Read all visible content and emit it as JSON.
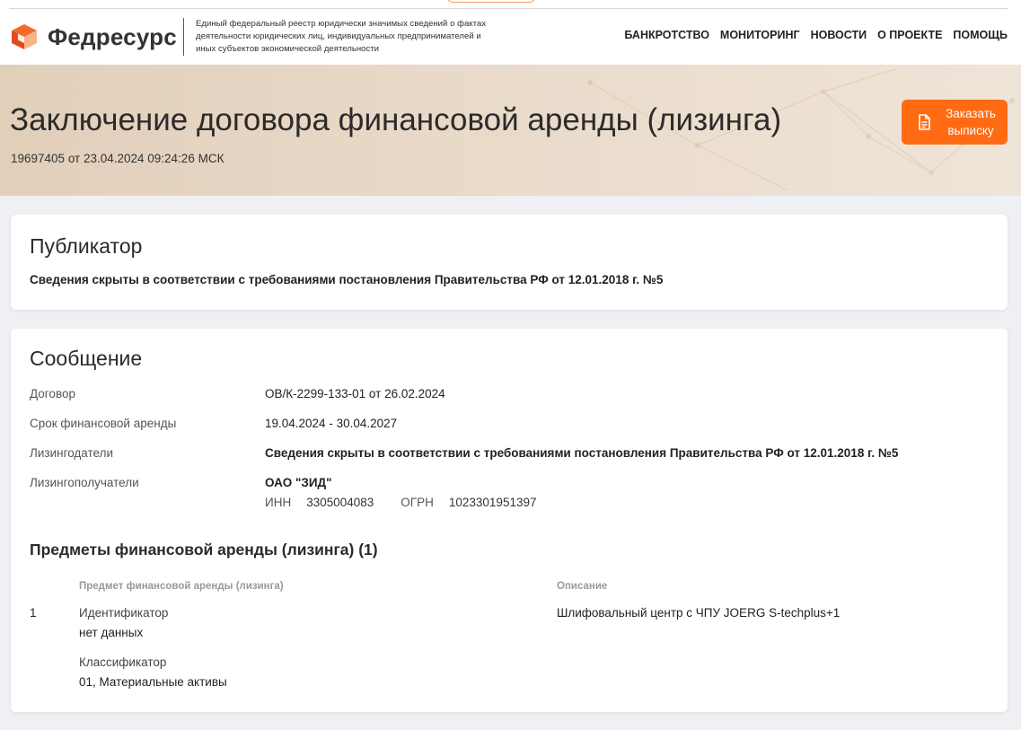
{
  "header": {
    "logo_text": "Федресурс",
    "tagline": "Единый федеральный реестр юридически значимых сведений о фактах деятельности юридических лиц, индивидуальных предпринимателей и иных субъектов экономической деятельности",
    "nav": [
      "БАНКРОТСТВО",
      "МОНИТОРИНГ",
      "НОВОСТИ",
      "О ПРОЕКТЕ",
      "ПОМОЩЬ"
    ]
  },
  "hero": {
    "title": "Заключение договора финансовой аренды (лизинга)",
    "subtitle": "19697405 от 23.04.2024 09:24:26 МСК",
    "order_button": "Заказать выписку"
  },
  "publisher": {
    "title": "Публикатор",
    "text": "Сведения скрыты в соответствии с требованиями постановления Правительства РФ от 12.01.2018 г. №5"
  },
  "message": {
    "title": "Сообщение",
    "fields": [
      {
        "label": "Договор",
        "value": "ОВ/К-2299-133-01 от 26.02.2024"
      },
      {
        "label": "Срок финансовой аренды",
        "value": "19.04.2024 - 30.04.2027"
      },
      {
        "label": "Лизингодатели",
        "value": "Сведения скрыты в соответствии с требованиями постановления Правительства РФ от 12.01.2018 г. №5"
      },
      {
        "label": "Лизингополучатели",
        "value": "ОАО \"ЗИД\""
      }
    ],
    "lessee_ids": {
      "inn_label": "ИНН",
      "inn": "3305004083",
      "ogrn_label": "ОГРН",
      "ogrn": "1023301951397"
    },
    "subjects_title": "Предметы финансовой аренды (лизинга) (1)",
    "table": {
      "headers": [
        "Предмет финансовой аренды (лизинга)",
        "Описание"
      ],
      "rows": [
        {
          "num": "1",
          "identifier_label": "Идентификатор",
          "identifier_value": "нет данных",
          "classifier_label": "Классификатор",
          "classifier_value": "01, Материальные активы",
          "description": "Шлифовальный центр с ЧПУ JOERG S-techplus+1"
        }
      ]
    }
  },
  "colors": {
    "accent": "#ff6a13",
    "hero_bg": "#e6d5c2",
    "page_bg": "#eef0f3"
  }
}
